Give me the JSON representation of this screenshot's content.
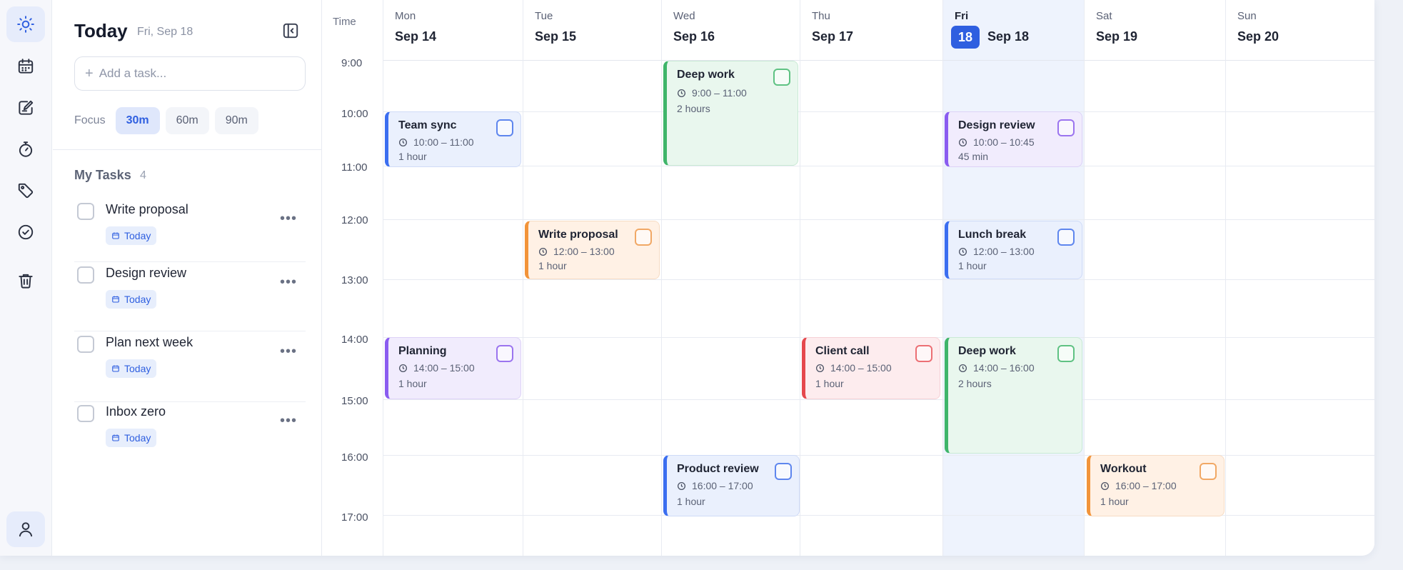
{
  "sidebar": {
    "title": "Today",
    "date": "Fri, Sep 18",
    "add_task_placeholder": "Add a task...",
    "focus_label": "Focus",
    "focus_options": [
      "30m",
      "60m",
      "90m"
    ],
    "focus_selected": "30m",
    "my_tasks_label": "My Tasks",
    "my_tasks_count": "4",
    "tasks": [
      {
        "name": "Write proposal",
        "badge": "Today"
      },
      {
        "name": "Design review",
        "badge": "Today"
      },
      {
        "name": "Plan next week",
        "badge": "Today"
      },
      {
        "name": "Inbox zero",
        "badge": "Today"
      }
    ]
  },
  "rail": {
    "items": [
      "sun-icon",
      "calendar-icon",
      "notes-icon",
      "timer-icon",
      "tag-icon",
      "check-circle-icon",
      "trash-icon",
      "user-icon"
    ],
    "active": "sun-icon"
  },
  "calendar": {
    "time_header": "Time",
    "hours": [
      "9:00",
      "10:00",
      "11:00",
      "12:00",
      "13:00",
      "14:00",
      "15:00",
      "16:00",
      "17:00"
    ],
    "days": [
      {
        "name": "Mon",
        "date": "Sep 14"
      },
      {
        "name": "Tue",
        "date": "Sep 15"
      },
      {
        "name": "Wed",
        "date": "Sep 16"
      },
      {
        "name": "Thu",
        "date": "Sep 17"
      },
      {
        "name": "Fri",
        "date": "Sep 18",
        "today_number": "18"
      },
      {
        "name": "Sat",
        "date": "Sep 19"
      },
      {
        "name": "Sun",
        "date": "Sep 20"
      }
    ],
    "events": [
      {
        "title": "Deep work",
        "time": "9:00 – 11:00",
        "duration": "2 hours",
        "color": "#3fb56a"
      },
      {
        "title": "Team sync",
        "time": "10:00 – 11:00",
        "duration": "1 hour",
        "color": "#3b6ef0"
      },
      {
        "title": "Design review",
        "time": "10:00 – 10:45",
        "duration": "45 min",
        "color": "#8a5cf0"
      },
      {
        "title": "Write proposal",
        "time": "12:00 – 13:00",
        "duration": "1 hour",
        "color": "#f2943a"
      },
      {
        "title": "Lunch break",
        "time": "12:00 – 13:00",
        "duration": "1 hour",
        "color": "#3b6ef0"
      },
      {
        "title": "Planning",
        "time": "14:00 – 15:00",
        "duration": "1 hour",
        "color": "#8a5cf0"
      },
      {
        "title": "Client call",
        "time": "14:00 – 15:00",
        "duration": "1 hour",
        "color": "#e5484d"
      },
      {
        "title": "Deep work",
        "time": "14:00 – 16:00",
        "duration": "2 hours",
        "color": "#3fb56a"
      },
      {
        "title": "Product review",
        "time": "16:00 – 17:00",
        "duration": "1 hour",
        "color": "#3b6ef0"
      },
      {
        "title": "Workout",
        "time": "16:00 – 17:00",
        "duration": "1 hour",
        "color": "#f2943a"
      }
    ]
  },
  "colors": {
    "accent": "#2f5fe0",
    "today_column": "#eef3fd"
  }
}
